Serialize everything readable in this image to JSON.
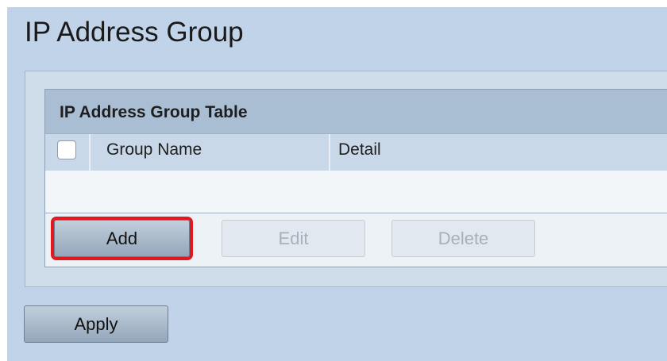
{
  "page": {
    "title": "IP Address Group"
  },
  "table": {
    "title": "IP Address Group Table",
    "columns": [
      "Group Name",
      "Detail"
    ],
    "select_all_checked": false,
    "rows": []
  },
  "actions": {
    "add_label": "Add",
    "edit_label": "Edit",
    "delete_label": "Delete",
    "edit_enabled": false,
    "delete_enabled": false,
    "highlighted": "Add"
  },
  "footer": {
    "apply_label": "Apply"
  },
  "colors": {
    "page_background": "#c1d3e8",
    "table_header": "#a9bdd3",
    "highlight": "#e3181f"
  }
}
